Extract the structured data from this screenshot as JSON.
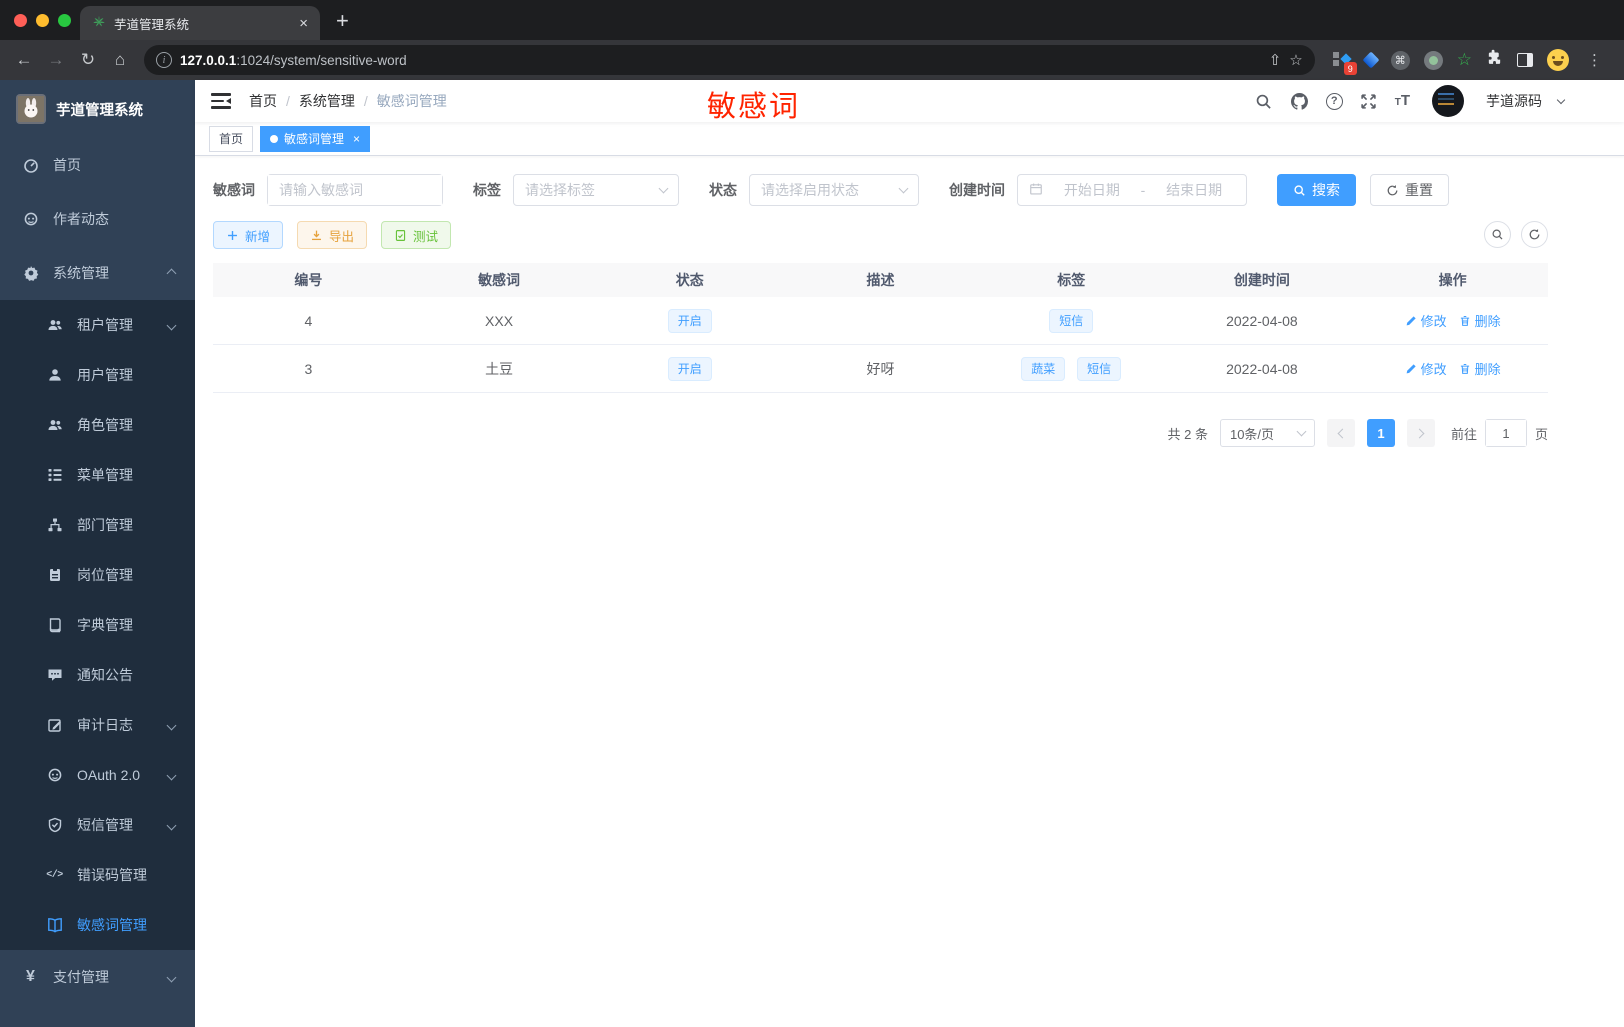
{
  "browser": {
    "tab_title": "芋道管理系统",
    "url_host": "127.0.0.1",
    "url_path": ":1024/system/sensitive-word",
    "extension_badge": "9"
  },
  "icons": {
    "back": "←",
    "forward": "→",
    "reload": "↻",
    "home": "⌂",
    "command": "⌘",
    "star": "☆",
    "ext_star": "☆",
    "menu_dots": "⋮",
    "tab_close": "×",
    "new_tab": "+",
    "info": "i",
    "share": "⇧",
    "help": "?",
    "code": "</>",
    "yen": "¥",
    "tag_close": "×",
    "tt_small": "T",
    "tt_big": "T"
  },
  "sidebar": {
    "title": "芋道管理系统",
    "items": [
      {
        "label": "首页"
      },
      {
        "label": "作者动态"
      },
      {
        "label": "系统管理"
      }
    ],
    "system_children": [
      {
        "label": "租户管理"
      },
      {
        "label": "用户管理"
      },
      {
        "label": "角色管理"
      },
      {
        "label": "菜单管理"
      },
      {
        "label": "部门管理"
      },
      {
        "label": "岗位管理"
      },
      {
        "label": "字典管理"
      },
      {
        "label": "通知公告"
      },
      {
        "label": "审计日志"
      },
      {
        "label": "OAuth 2.0"
      },
      {
        "label": "短信管理"
      },
      {
        "label": "错误码管理"
      },
      {
        "label": "敏感词管理"
      }
    ],
    "bottom_item": {
      "label": "支付管理"
    }
  },
  "navbar": {
    "breadcrumb": [
      "首页",
      "系统管理",
      "敏感词管理"
    ],
    "annotation": "敏感词",
    "username": "芋道源码"
  },
  "tags_view": {
    "home": "首页",
    "active": "敏感词管理"
  },
  "filters": {
    "keyword_label": "敏感词",
    "keyword_placeholder": "请输入敏感词",
    "tag_label": "标签",
    "tag_placeholder": "请选择标签",
    "status_label": "状态",
    "status_placeholder": "请选择启用状态",
    "date_label": "创建时间",
    "date_start": "开始日期",
    "date_sep": "-",
    "date_end": "结束日期",
    "search_label": "搜索",
    "reset_label": "重置"
  },
  "toolbar": {
    "add": "新增",
    "export": "导出",
    "test": "测试"
  },
  "table": {
    "columns": [
      "编号",
      "敏感词",
      "状态",
      "描述",
      "标签",
      "创建时间",
      "操作"
    ],
    "rows": [
      {
        "id": "4",
        "word": "XXX",
        "status": "开启",
        "description": "",
        "tags": [
          "短信"
        ],
        "created": "2022-04-08",
        "edit": "修改",
        "remove": "删除"
      },
      {
        "id": "3",
        "word": "土豆",
        "status": "开启",
        "description": "好呀",
        "tags": [
          "蔬菜",
          "短信"
        ],
        "created": "2022-04-08",
        "edit": "修改",
        "remove": "删除"
      }
    ]
  },
  "pagination": {
    "total": "共 2 条",
    "page_size": "10条/页",
    "current_page": "1",
    "goto_label": "前往",
    "goto_value": "1",
    "unit": "页"
  },
  "colors": {
    "accent": "#409eff",
    "annotation_red": "#ff2400",
    "warning": "#e6a23c",
    "success": "#67c23a",
    "sidebar_bg": "#304156",
    "submenu_bg": "#1f2d3d"
  }
}
